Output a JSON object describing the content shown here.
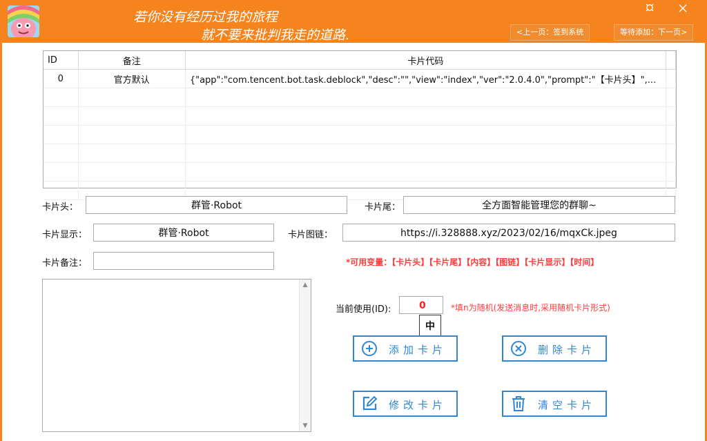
{
  "titlebar": {
    "slogan_line1": "若你没有经历过我的旅程",
    "slogan_line2": "就不要来批判我走的道路.",
    "prev_btn": "<上一页：签到系统",
    "next_btn": "等待添加：下一页>",
    "pin_icon": "pin-icon",
    "close_icon": "close-icon"
  },
  "table": {
    "headers": [
      "ID",
      "备注",
      "卡片代码"
    ],
    "rows": [
      [
        "0",
        "官方默认",
        "{\"app\":\"com.tencent.bot.task.deblock\",\"desc\":\"\",\"view\":\"index\",\"ver\":\"2.0.4.0\",\"prompt\":\"【卡片头】\",..."
      ]
    ]
  },
  "form": {
    "head_label": "卡片头：",
    "head_value": "群管·Robot",
    "tail_label": "卡片尾：",
    "tail_value": "全方面智能管理您的群聊~",
    "display_label": "卡片显示：",
    "display_value": "群管·Robot",
    "imglink_label": "卡片图链：",
    "imglink_value": "https://i.328888.xyz/2023/02/16/mqxCk.jpeg",
    "note_label": "卡片备注：",
    "note_value": "",
    "vars_hint": "*可用变量：【卡片头】【卡片尾】【内容】【图链】【卡片显示】【时间】",
    "current_label": "当前使用(ID):",
    "current_value": "0",
    "current_hint": "*填n为随机(发送消息时,采用随机卡片形式)",
    "ime_indicator": "中"
  },
  "buttons": {
    "add": "添加卡片",
    "delete": "删除卡片",
    "edit": "修改卡片",
    "clear": "清空卡片"
  },
  "colors": {
    "accent": "#f5841f",
    "button_blue": "#2d86d6",
    "hint_red": "#ff3b3b"
  }
}
